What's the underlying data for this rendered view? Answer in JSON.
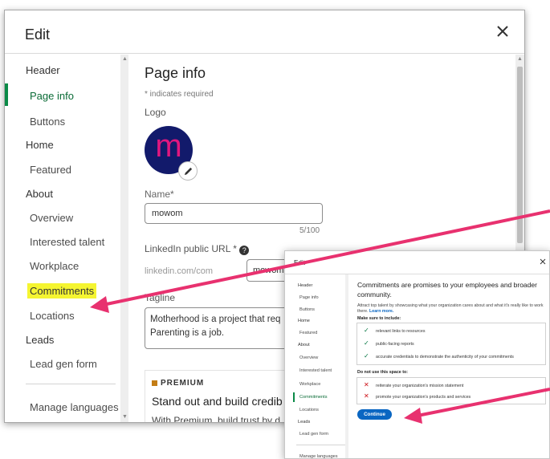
{
  "main_dialog": {
    "title": "Edit",
    "nav": [
      {
        "key": "header",
        "label": "Header",
        "kind": "heading"
      },
      {
        "key": "page_info",
        "label": "Page info",
        "kind": "item",
        "active": true
      },
      {
        "key": "buttons",
        "label": "Buttons",
        "kind": "item"
      },
      {
        "key": "home",
        "label": "Home",
        "kind": "heading"
      },
      {
        "key": "featured",
        "label": "Featured",
        "kind": "item"
      },
      {
        "key": "about",
        "label": "About",
        "kind": "heading"
      },
      {
        "key": "overview",
        "label": "Overview",
        "kind": "item"
      },
      {
        "key": "interested_talent",
        "label": "Interested talent",
        "kind": "item"
      },
      {
        "key": "workplace",
        "label": "Workplace",
        "kind": "item"
      },
      {
        "key": "commitments",
        "label": "Commitments",
        "kind": "item",
        "highlighted": true
      },
      {
        "key": "locations",
        "label": "Locations",
        "kind": "item"
      },
      {
        "key": "leads",
        "label": "Leads",
        "kind": "heading"
      },
      {
        "key": "lead_gen_form",
        "label": "Lead gen form",
        "kind": "item"
      },
      {
        "key": "manage_languages",
        "label": "Manage languages",
        "kind": "item"
      }
    ],
    "page_info": {
      "heading": "Page info",
      "required_note": "* indicates required",
      "logo_label": "Logo",
      "logo_letter": "m",
      "name_label": "Name*",
      "name_value": "mowom",
      "name_counter": "5/100",
      "url_label": "LinkedIn public URL *",
      "url_prefix": "linkedin.com/com",
      "url_value": "mowom",
      "tagline_label": "Tagline",
      "tagline_value": "Motherhood is a project that req\nParenting is a job.",
      "premium_badge": "PREMIUM",
      "premium_title": "Stand out and build credib",
      "premium_text": "With Premium, build trust by d"
    }
  },
  "second_dialog": {
    "title": "Edit",
    "nav": [
      "Header",
      "Page info",
      "Buttons",
      "Home",
      "Featured",
      "About",
      "Overview",
      "Interested talent",
      "Workplace",
      "Commitments",
      "Locations",
      "Leads",
      "Lead gen form",
      "Manage languages"
    ],
    "heading": "Commitments are promises to your employees and broader community.",
    "description": "Attract top talent by showcasing what your organization cares about and what it's really like to work there.",
    "learn_more": "Learn more.",
    "include_label": "Make sure to include:",
    "include_items": [
      "relevant links to resources",
      "public-facing reports",
      "accurate credentials to demonstrate the authenticity of your commitments"
    ],
    "exclude_label": "Do not use this space to:",
    "exclude_items": [
      "reiterate your organization's mission statement",
      "promote your organization's products and services"
    ],
    "continue_label": "Continue"
  },
  "colors": {
    "accent_green": "#0a8a47",
    "highlight_yellow": "#f5f531",
    "annotation_arrow": "#e8316f",
    "button_blue": "#0a66c2",
    "logo_bg": "#121a6b",
    "logo_letter": "#e0177f",
    "premium_gold": "#c37d16",
    "check_green": "#057642",
    "cross_red": "#cc1016"
  }
}
